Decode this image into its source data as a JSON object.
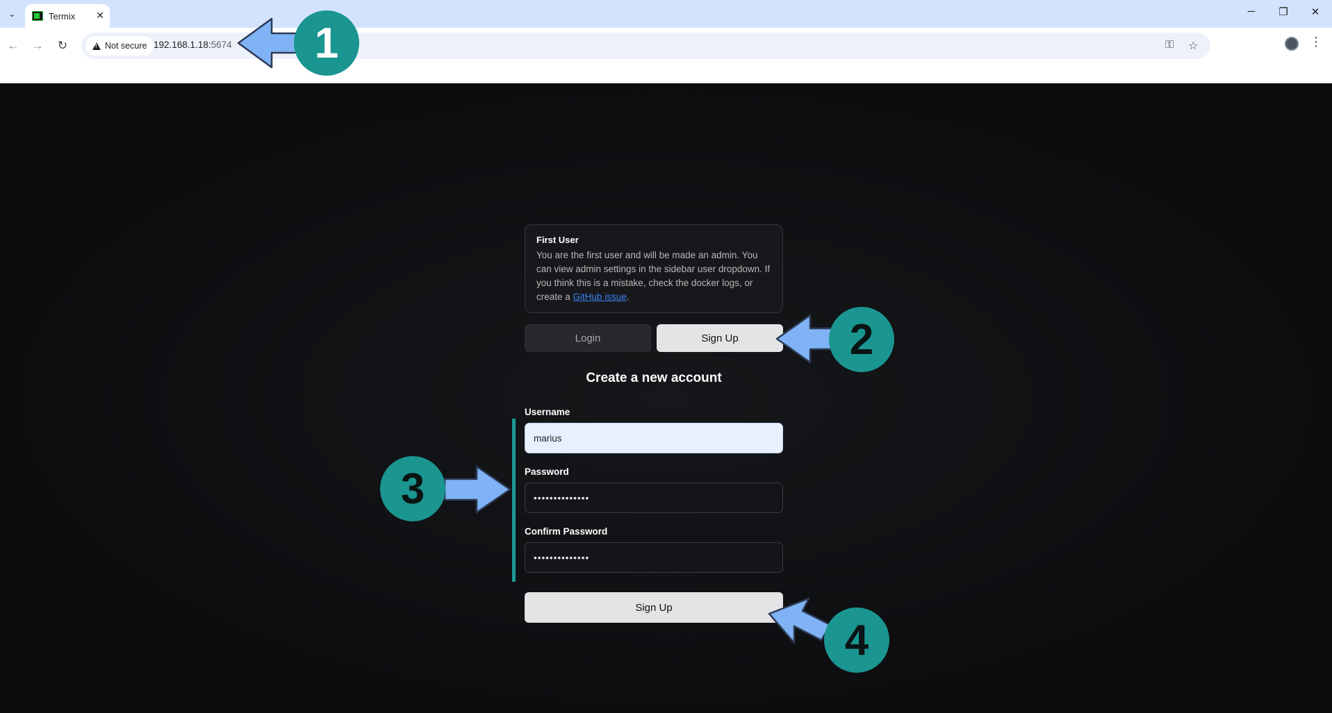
{
  "browser": {
    "tab_title": "Termix",
    "security_label": "Not secure",
    "url_host": "192.168.1.18:",
    "url_port": "5674"
  },
  "info": {
    "title": "First User",
    "text": "You are the first user and will be made an admin. You can view admin settings in the sidebar user dropdown. If you think this is a mistake, check the docker logs, or create a ",
    "link": "GitHub issue",
    "text_end": "."
  },
  "auth_tabs": {
    "login": "Login",
    "signup": "Sign Up"
  },
  "form": {
    "heading": "Create a new account",
    "username_label": "Username",
    "username_value": "marius",
    "password_label": "Password",
    "password_value": "••••••••••••••",
    "confirm_label": "Confirm Password",
    "confirm_value": "••••••••••••••",
    "submit": "Sign Up"
  },
  "annotations": {
    "steps": [
      "1",
      "2",
      "3",
      "4"
    ]
  },
  "colors": {
    "annotation_badge": "#1a9590",
    "annotation_arrow": "#7fb3f5",
    "focus_bar": "#1b9a96"
  }
}
